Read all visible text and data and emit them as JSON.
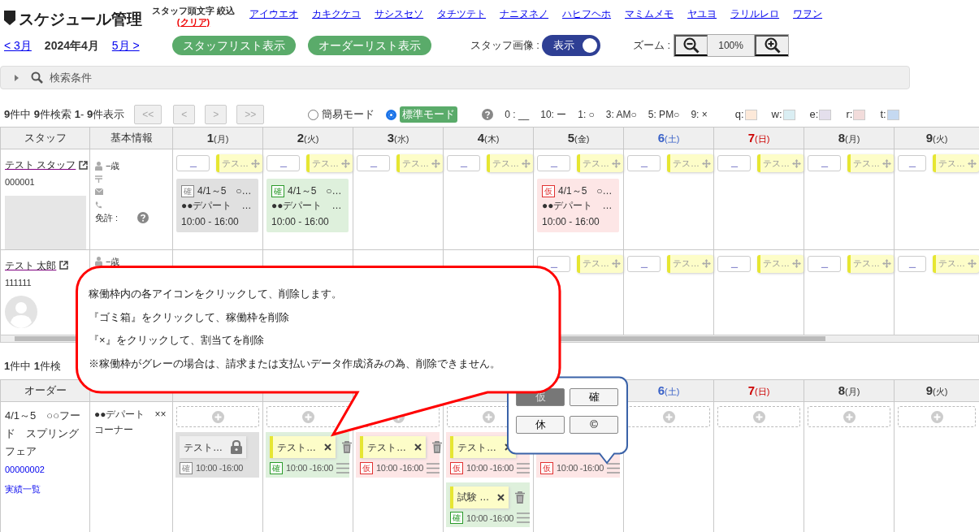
{
  "header": {
    "title": "スケジュール管理",
    "filter_label": "スタッフ頭文字 絞込",
    "clear_link": "(クリア)",
    "kana_links": [
      "アイウエオ",
      "カキクケコ",
      "サシスセソ",
      "タチツテト",
      "ナニヌネノ",
      "ハヒフヘホ",
      "マミムメモ",
      "ヤユヨ",
      "ラリルレロ",
      "ワヲン"
    ]
  },
  "month_nav": {
    "prev": "< 3月",
    "current": "2024年4月",
    "next": "5月 >"
  },
  "buttons": [
    "スタッフリスト表示",
    "オーダーリスト表示"
  ],
  "staff_image": {
    "label": "スタッフ画像 :",
    "toggle_text": "表示",
    "on": true
  },
  "zoom": {
    "label": "ズーム :",
    "value": "100%"
  },
  "search_panel": {
    "label": "検索条件",
    "expanded": false
  },
  "staff_summary": "**9**件中 **9**件検索 **1**- **9**件表示",
  "pager": [
    "<<",
    "<",
    ">",
    ">>"
  ],
  "modes": [
    {
      "label": "簡易モード",
      "selected": false
    },
    {
      "label": "標準モード",
      "selected": true
    }
  ],
  "legend": [
    "0 : __",
    "10: ー",
    "1: ○",
    "3: AM○",
    "5: PM○",
    "9: ×"
  ],
  "color_legend": [
    {
      "label": "q:",
      "color": "#fde9d9"
    },
    {
      "label": "w:",
      "color": "#daeef3"
    },
    {
      "label": "e:",
      "color": "#e4dfec"
    },
    {
      "label": "r:",
      "color": "#f2dcdb"
    },
    {
      "label": "t:",
      "color": "#c5d9f1"
    }
  ],
  "staff_table": {
    "columns": [
      "スタッフ",
      "基本情報"
    ],
    "days": [
      {
        "num": "1",
        "dow": "(月)",
        "kind": "weekday"
      },
      {
        "num": "2",
        "dow": "(火)",
        "kind": "weekday"
      },
      {
        "num": "3",
        "dow": "(水)",
        "kind": "weekday"
      },
      {
        "num": "4",
        "dow": "(木)",
        "kind": "weekday"
      },
      {
        "num": "5",
        "dow": "(金)",
        "kind": "weekday"
      },
      {
        "num": "6",
        "dow": "(土)",
        "kind": "saturday"
      },
      {
        "num": "7",
        "dow": "(日)",
        "kind": "sunday"
      },
      {
        "num": "8",
        "dow": "(月)",
        "kind": "weekday"
      },
      {
        "num": "9",
        "dow": "(火)",
        "kind": "weekday"
      }
    ],
    "rows": [
      {
        "kind": "photo",
        "name": "テスト スタッフ",
        "code": "000001",
        "age": "−歳",
        "license_label": "免許 :",
        "cells": [
          {
            "value": "＿",
            "tag": "テス…",
            "shift": {
              "kind": "locked",
              "badge": "確",
              "period": "4/1～5",
              "place": "○…",
              "store": "●●デパート",
              "more": "…",
              "time": "10:00 - 16:00"
            }
          },
          {
            "value": "＿",
            "tag": "テス…",
            "shift": {
              "kind": "confirmed",
              "badge": "確",
              "period": "4/1～5",
              "place": "○…",
              "store": "●●デパート",
              "more": "…",
              "time": "10:00 - 16:00"
            }
          },
          {
            "value": "＿",
            "tag": "テス…"
          },
          {
            "value": "＿",
            "tag": "テス…"
          },
          {
            "value": "＿",
            "tag": "テス…",
            "shift": {
              "kind": "tentative",
              "badge": "仮",
              "period": "4/1～5",
              "place": "○…",
              "store": "●●デパート",
              "more": "…",
              "time": "10:00 - 16:00"
            }
          },
          {
            "value": "＿",
            "tag": "テス…"
          },
          {
            "value": "＿",
            "tag": "テス…"
          },
          {
            "value": "＿",
            "tag": "テス…"
          },
          {
            "value": "＿",
            "tag": "テス…"
          }
        ]
      },
      {
        "kind": "avatar",
        "name": "テスト 太郎",
        "code": "111111",
        "age": "−歳",
        "cells": [
          {},
          {},
          {},
          {},
          {
            "value": "＿",
            "tag": "テス…"
          },
          {
            "value": "＿",
            "tag": "テス…"
          },
          {
            "value": "＿",
            "tag": "テス…"
          },
          {
            "value": "＿",
            "tag": "テス…"
          },
          {
            "value": "＿",
            "tag": "テス…"
          }
        ]
      }
    ]
  },
  "order_summary": "**1**件中 **1**件検",
  "order_table": {
    "column": "オーダー",
    "days": [
      {
        "num": "6",
        "dow": "(土)",
        "kind": "saturday"
      },
      {
        "num": "7",
        "dow": "(日)",
        "kind": "sunday"
      },
      {
        "num": "8",
        "dow": "(月)",
        "kind": "weekday"
      },
      {
        "num": "9",
        "dow": "(火)",
        "kind": "weekday"
      }
    ],
    "rows": [
      {
        "info": "4/1～5　○○フード　スプリングフェア",
        "code": "00000002",
        "link": "実績一覧",
        "place": "●●デパート　××コーナー",
        "cells": [
          {
            "shifts": [
              {
                "kind": "locked",
                "tag": "テスト…",
                "badge": "確",
                "time": "10:00 -16:00"
              }
            ]
          },
          {
            "shifts": [
              {
                "kind": "confirmed",
                "tag": "テスト…",
                "badge": "確",
                "time": "10:00 -16:00"
              }
            ]
          },
          {
            "shifts": [
              {
                "kind": "tentative",
                "tag": "テスト…",
                "badge": "仮",
                "time": "10:00 -16:00"
              }
            ]
          },
          {
            "shifts": [
              {
                "kind": "tentative",
                "tag": "テスト…",
                "badge": "仮",
                "time": "10:00 -16:00"
              },
              {
                "kind": "confirmed",
                "tag": "試験 …",
                "badge": "確",
                "time": "10:00 -16:00"
              }
            ]
          },
          {
            "shifts": [
              {
                "kind": "tentative",
                "badge": "仮",
                "time": "10:00 -16:00"
              }
            ]
          },
          {},
          {},
          {},
          {}
        ]
      }
    ]
  },
  "callout": {
    "lines": [
      "稼働枠内の各アイコンをクリックして、削除します。",
      "『ゴミ箱』をクリックして、稼働枠を削除",
      "『×』をクリックして、割当てを削除",
      "※稼働枠がグレーの場合は、請求または支払いデータ作成済みの為、削除できません。"
    ]
  },
  "status_popover": {
    "options": [
      {
        "label": "仮",
        "selected": true
      },
      {
        "label": "確",
        "selected": false
      },
      {
        "label": "休",
        "selected": false
      },
      {
        "label": "©",
        "selected": false
      }
    ]
  }
}
